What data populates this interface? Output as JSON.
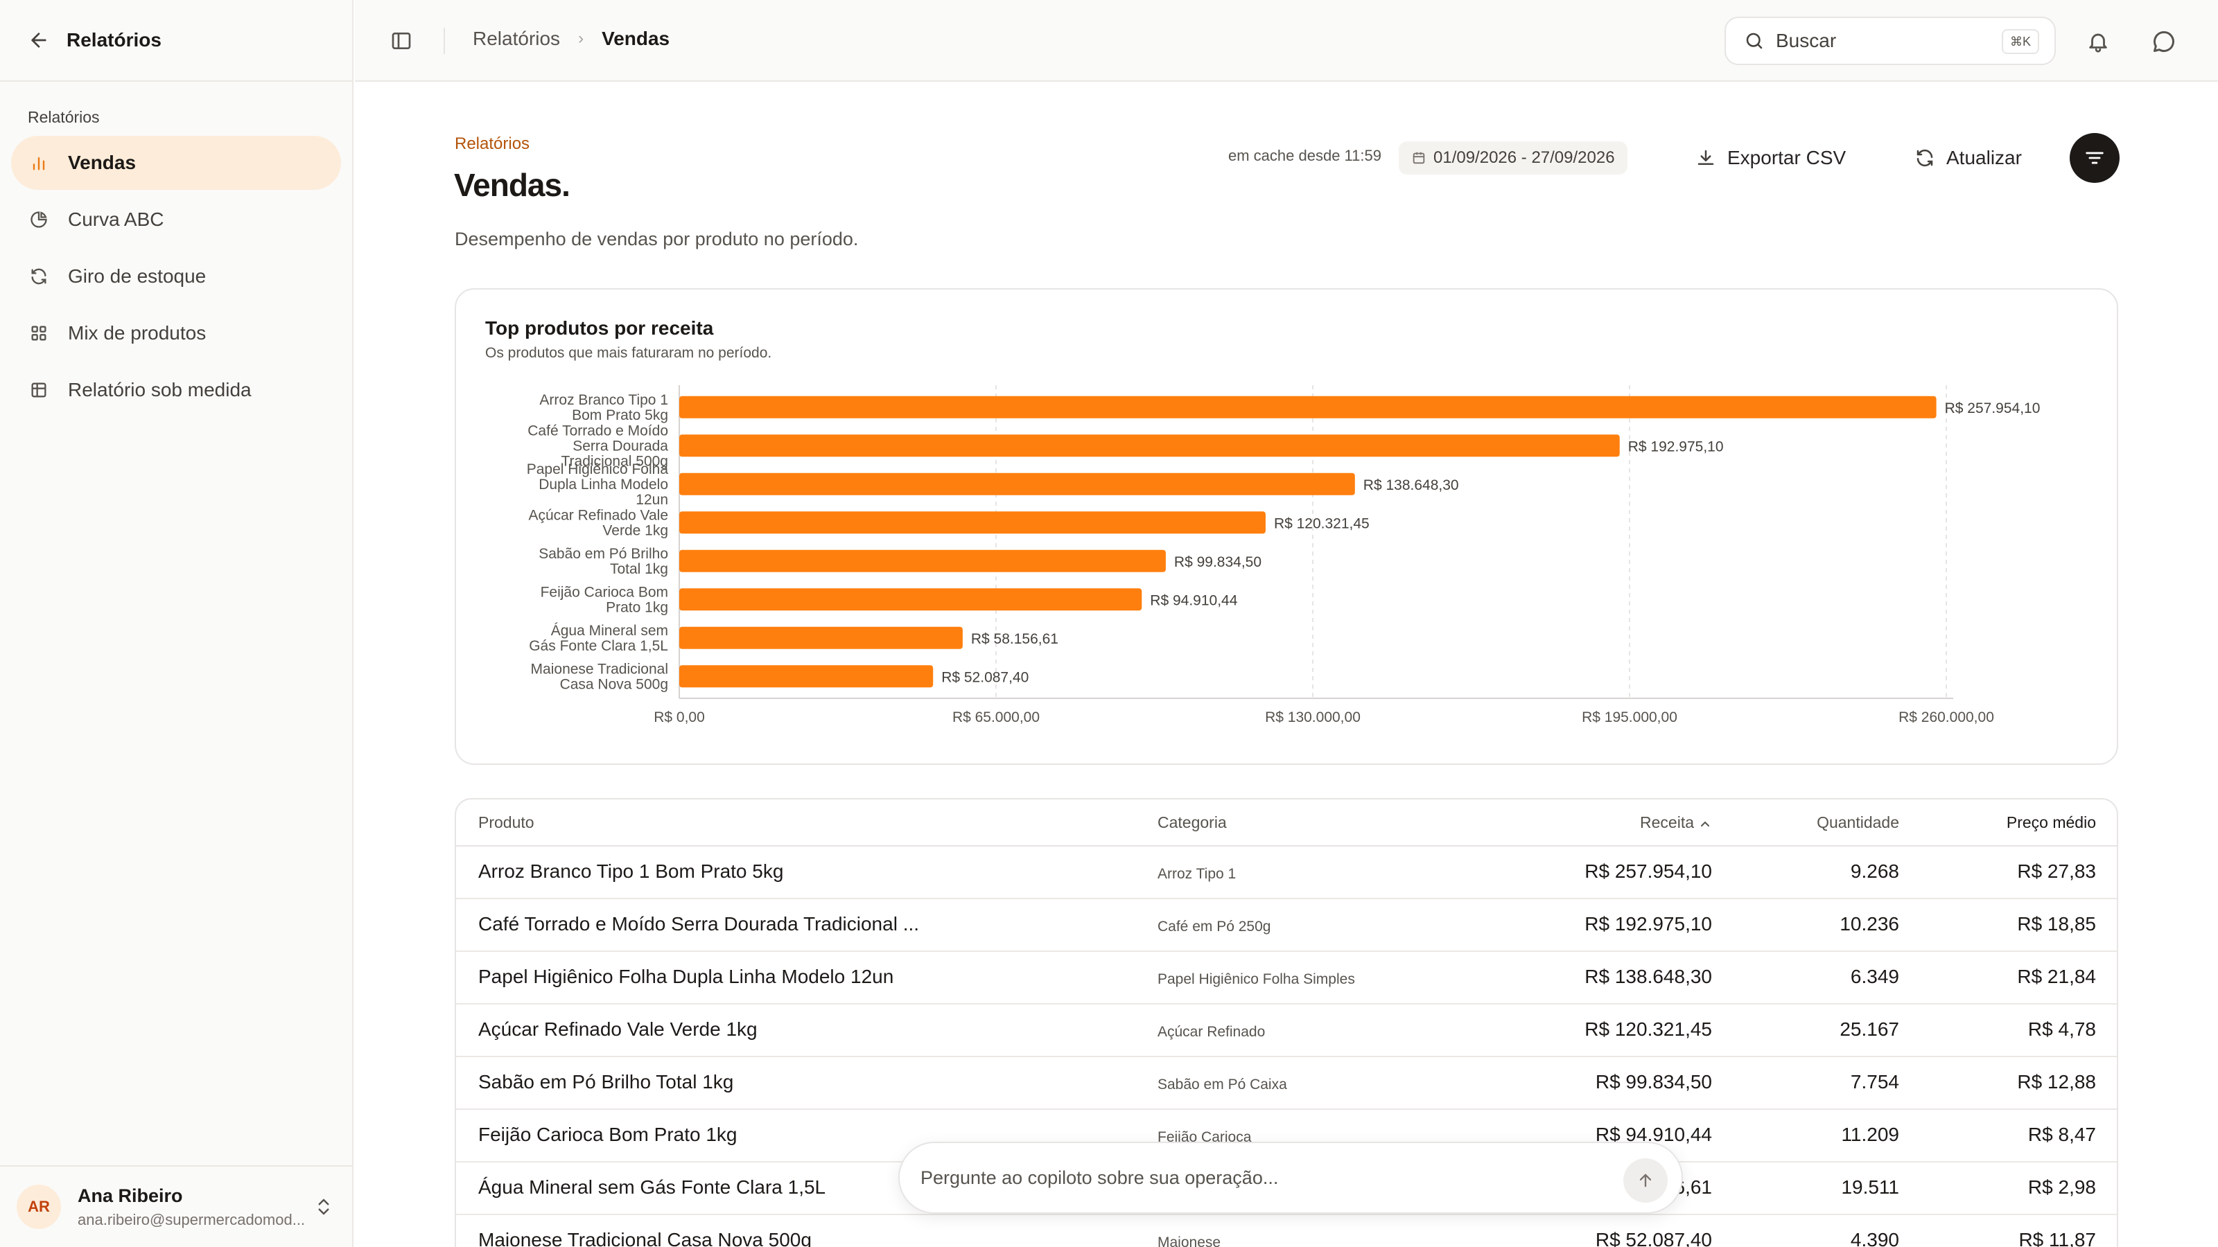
{
  "sidebar": {
    "title": "Relatórios",
    "group_label": "Relatórios",
    "items": [
      {
        "label": "Vendas",
        "icon": "bar-chart-icon"
      },
      {
        "label": "Curva ABC",
        "icon": "pie-chart-icon"
      },
      {
        "label": "Giro de estoque",
        "icon": "refresh-icon"
      },
      {
        "label": "Mix de produtos",
        "icon": "grid-icon"
      },
      {
        "label": "Relatório sob medida",
        "icon": "table-icon"
      }
    ],
    "user": {
      "initials": "AR",
      "name": "Ana Ribeiro",
      "email": "ana.ribeiro@supermercadomod..."
    }
  },
  "topbar": {
    "breadcrumb": [
      "Relatórios",
      "Vendas"
    ],
    "search_placeholder": "Buscar",
    "search_shortcut": "⌘K"
  },
  "header": {
    "eyebrow": "Relatórios",
    "title": "Vendas.",
    "description": "Desempenho de vendas por produto no período.",
    "cache_text": "em cache desde 11:59",
    "date_range": "01/09/2026 - 27/09/2026",
    "export_label": "Exportar CSV",
    "refresh_label": "Atualizar"
  },
  "chart_data": {
    "type": "bar",
    "orientation": "horizontal",
    "title": "Top produtos por receita",
    "subtitle": "Os produtos que mais faturaram no período.",
    "categories": [
      [
        "Arroz Branco Tipo 1",
        "Bom Prato 5kg"
      ],
      [
        "Café Torrado e Moído",
        "Serra Dourada",
        "Tradicional 500g"
      ],
      [
        "Papel Higiênico Folha",
        "Dupla Linha Modelo",
        "12un"
      ],
      [
        "Açúcar Refinado Vale",
        "Verde 1kg"
      ],
      [
        "Sabão em Pó Brilho",
        "Total 1kg"
      ],
      [
        "Feijão Carioca Bom",
        "Prato 1kg"
      ],
      [
        "Água Mineral sem",
        "Gás Fonte Clara 1,5L"
      ],
      [
        "Maionese Tradicional",
        "Casa Nova 500g"
      ]
    ],
    "values": [
      257954.1,
      192975.1,
      138648.3,
      120321.45,
      99834.5,
      94910.44,
      58156.61,
      52087.4
    ],
    "value_labels": [
      "R$ 257.954,10",
      "R$ 192.975,10",
      "R$ 138.648,30",
      "R$ 120.321,45",
      "R$ 99.834,50",
      "R$ 94.910,44",
      "R$ 58.156,61",
      "R$ 52.087,40"
    ],
    "xlim": [
      0,
      260000
    ],
    "xticks": [
      0,
      65000,
      130000,
      195000,
      260000
    ],
    "xtick_labels": [
      "R$ 0,00",
      "R$ 65.000,00",
      "R$ 130.000,00",
      "R$ 195.000,00",
      "R$ 260.000,00"
    ],
    "grid": "vertical dashed",
    "bar_color": "#ff7f0e"
  },
  "table": {
    "columns": [
      "Produto",
      "Categoria",
      "Receita",
      "Quantidade",
      "Preço médio"
    ],
    "sort_indicator": "^",
    "rows": [
      {
        "produto": "Arroz Branco Tipo 1 Bom Prato 5kg",
        "categoria": "Arroz Tipo 1",
        "receita": "R$ 257.954,10",
        "quantidade": "9.268",
        "preco": "R$ 27,83"
      },
      {
        "produto": "Café Torrado e Moído Serra Dourada Tradicional ...",
        "categoria": "Café em Pó 250g",
        "receita": "R$ 192.975,10",
        "quantidade": "10.236",
        "preco": "R$ 18,85"
      },
      {
        "produto": "Papel Higiênico Folha Dupla Linha Modelo 12un",
        "categoria": "Papel Higiênico Folha Simples",
        "receita": "R$ 138.648,30",
        "quantidade": "6.349",
        "preco": "R$ 21,84"
      },
      {
        "produto": "Açúcar Refinado Vale Verde 1kg",
        "categoria": "Açúcar Refinado",
        "receita": "R$ 120.321,45",
        "quantidade": "25.167",
        "preco": "R$ 4,78"
      },
      {
        "produto": "Sabão em Pó Brilho Total 1kg",
        "categoria": "Sabão em Pó Caixa",
        "receita": "R$ 99.834,50",
        "quantidade": "7.754",
        "preco": "R$ 12,88"
      },
      {
        "produto": "Feijão Carioca Bom Prato 1kg",
        "categoria": "Feijão Carioca",
        "receita": "R$ 94.910,44",
        "quantidade": "11.209",
        "preco": "R$ 8,47"
      },
      {
        "produto": "Água Mineral sem Gás Fonte Clara 1,5L",
        "categoria": "",
        "receita": "6,61",
        "quantidade": "19.511",
        "preco": "R$ 2,98"
      },
      {
        "produto": "Maionese Tradicional Casa Nova 500g",
        "categoria": "Maionese",
        "receita": "R$ 52.087,40",
        "quantidade": "4.390",
        "preco": "R$ 11,87"
      }
    ]
  },
  "copilot": {
    "placeholder": "Pergunte ao copiloto sobre sua operação..."
  }
}
